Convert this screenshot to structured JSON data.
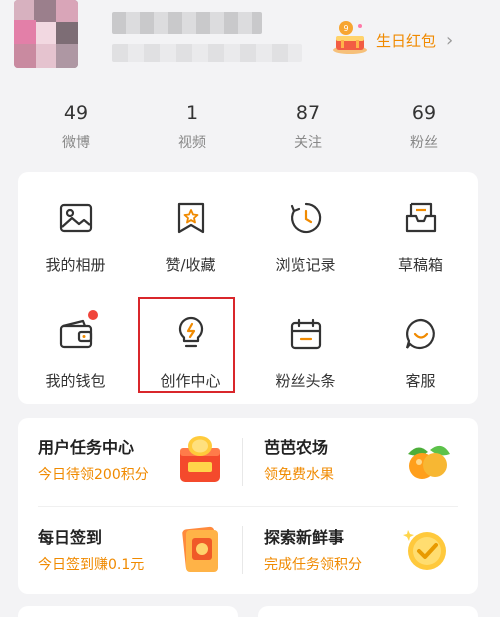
{
  "header": {
    "birthday_label": "生日红包",
    "birthday_chevron": "›"
  },
  "stats": [
    {
      "value": "49",
      "label": "微博"
    },
    {
      "value": "1",
      "label": "视频"
    },
    {
      "value": "87",
      "label": "关注"
    },
    {
      "value": "69",
      "label": "粉丝"
    }
  ],
  "menu": [
    {
      "label": "我的相册",
      "icon": "photo-album-icon"
    },
    {
      "label": "赞/收藏",
      "icon": "favorite-bookmark-icon"
    },
    {
      "label": "浏览记录",
      "icon": "history-clock-icon"
    },
    {
      "label": "草稿箱",
      "icon": "drafts-tray-icon"
    },
    {
      "label": "我的钱包",
      "icon": "wallet-icon"
    },
    {
      "label": "创作中心",
      "icon": "creator-bulb-icon"
    },
    {
      "label": "粉丝头条",
      "icon": "calendar-icon"
    },
    {
      "label": "客服",
      "icon": "chat-smile-icon"
    }
  ],
  "tasks": [
    {
      "title": "用户任务中心",
      "subtitle": "今日待领200积分",
      "icon": "coin-gift-icon"
    },
    {
      "title": "芭芭农场",
      "subtitle": "领免费水果",
      "icon": "fruit-icon"
    },
    {
      "title": "每日签到",
      "subtitle": "今日签到赚0.1元",
      "icon": "signin-card-icon"
    },
    {
      "title": "探索新鲜事",
      "subtitle": "完成任务领积分",
      "icon": "gold-check-icon"
    }
  ],
  "colors": {
    "accent": "#f08a00",
    "highlight": "#d9262b",
    "badge": "#f0443a"
  }
}
